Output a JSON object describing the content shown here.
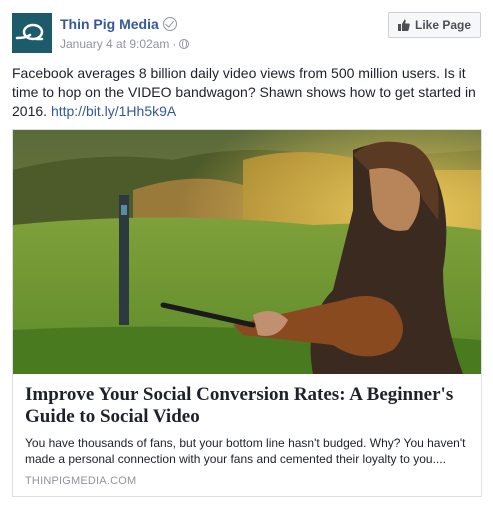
{
  "post": {
    "page_name": "Thin Pig Media",
    "timestamp": "January 4 at 9:02am",
    "separator": "·",
    "like_button_label": "Like Page",
    "text": "Facebook averages 8 billion daily video views from 500 million users. Is it time to hop on the VIDEO bandwagon? Shawn shows how to get started in 2016.",
    "link": "http://bit.ly/1Hh5k9A"
  },
  "card": {
    "title": "Improve Your Social Conversion Rates: A Beginner's Guide to Social Video",
    "description": "You have thousands of fans, but your bottom line hasn't budged. Why? You haven't made a personal connection with your fans and cemented their loyalty to you....",
    "domain": "THINPIGMEDIA.COM"
  },
  "icons": {
    "verified": "verified-badge-icon",
    "audience": "globe-icon",
    "like": "thumbs-up-icon"
  },
  "colors": {
    "link": "#365899",
    "secondary_text": "#90949c",
    "avatar_bg": "#1d5b6b"
  }
}
